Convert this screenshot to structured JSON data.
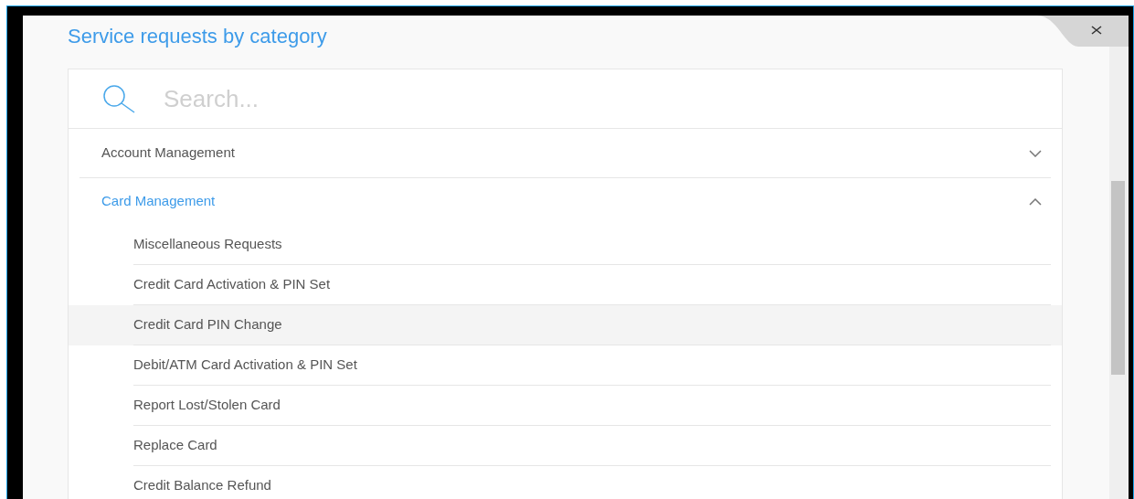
{
  "title": "Service requests by category",
  "search": {
    "placeholder": "Search..."
  },
  "categories": [
    {
      "label": "Account Management",
      "expanded": false
    },
    {
      "label": "Card Management",
      "expanded": true,
      "children": [
        {
          "label": "Miscellaneous Requests",
          "selected": false
        },
        {
          "label": "Credit Card Activation & PIN Set",
          "selected": false
        },
        {
          "label": "Credit Card PIN Change",
          "selected": true
        },
        {
          "label": "Debit/ATM Card Activation & PIN Set",
          "selected": false
        },
        {
          "label": "Report Lost/Stolen Card",
          "selected": false
        },
        {
          "label": "Replace Card",
          "selected": false
        },
        {
          "label": "Credit Balance Refund",
          "selected": false
        }
      ]
    }
  ]
}
